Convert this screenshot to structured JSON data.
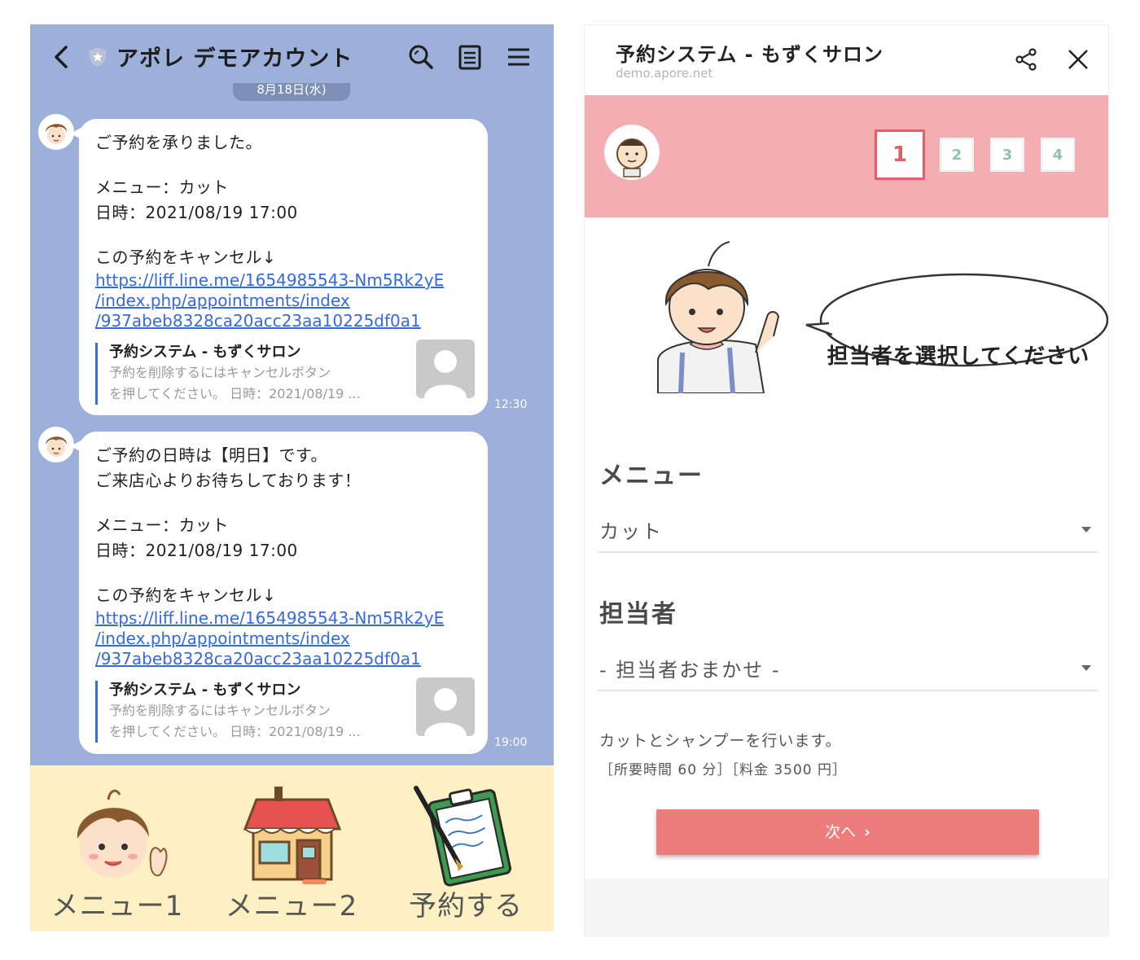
{
  "chat": {
    "title": "アポレ デモアカウント",
    "date_pill": "8月18日(水)",
    "messages": [
      {
        "greeting": "ご予約を承りました。",
        "greeting2": "",
        "menu_line": "メニュー：カット",
        "datetime_line": "日時：2021/08/19 17:00",
        "cancel_line": "この予約をキャンセル↓",
        "link_1": "https://liff.line.me/1654985543-Nm5Rk2yE",
        "link_2": "/index.php/appointments/index",
        "link_3": "/937abeb8328ca20acc23aa10225df0a1",
        "preview_title": "予約システム - もずくサロン",
        "preview_desc_1": "予約を削除するにはキャンセルボタン",
        "preview_desc_2": "を押してください。 日時：2021/08/19 ...",
        "time": "12:30"
      },
      {
        "greeting": "ご予約の日時は【明日】です。",
        "greeting2": "ご来店心よりお待ちしております！",
        "menu_line": "メニュー：カット",
        "datetime_line": "日時：2021/08/19 17:00",
        "cancel_line": "この予約をキャンセル↓",
        "link_1": "https://liff.line.me/1654985543-Nm5Rk2yE",
        "link_2": "/index.php/appointments/index",
        "link_3": "/937abeb8328ca20acc23aa10225df0a1",
        "preview_title": "予約システム - もずくサロン",
        "preview_desc_1": "予約を削除するにはキャンセルボタン",
        "preview_desc_2": "を押してください。 日時：2021/08/19 ...",
        "time": "19:00"
      }
    ],
    "rich_menu": [
      {
        "label": "メニュー1",
        "icon": "boy-waving-icon"
      },
      {
        "label": "メニュー2",
        "icon": "shop-icon"
      },
      {
        "label": "予約する",
        "icon": "clipboard-pen-icon"
      }
    ],
    "colors": {
      "background": "#9db0d9",
      "link": "#3569e0",
      "rich_menu_bg": "#fdf1c4"
    }
  },
  "liff": {
    "title": "予約システム - もずくサロン",
    "domain": "demo.apore.net",
    "steps": [
      "1",
      "2",
      "3",
      "4"
    ],
    "active_step": "1",
    "speech": "担当者を選択してください",
    "menu_label": "メニュー",
    "menu_value": "カット",
    "staff_label": "担当者",
    "staff_value": "- 担当者おまかせ -",
    "description": "カットとシャンプーを行います。",
    "meta": "［所要時間 60 分］［料金 3500 円］",
    "next_button": "次へ",
    "colors": {
      "step_bar": "#f4adb1",
      "accent": "#e25f67",
      "button": "#ec7d7a"
    }
  }
}
